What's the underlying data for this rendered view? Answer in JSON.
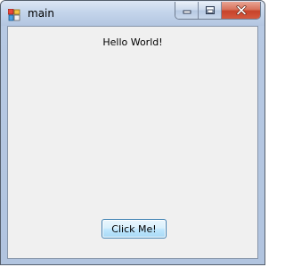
{
  "window": {
    "title": "main",
    "icon": "winforms-app-icon"
  },
  "caption_buttons": {
    "minimize_icon": "minimize-icon",
    "maximize_icon": "maximize-icon",
    "close_icon": "close-icon"
  },
  "form": {
    "label_text": "Hello World!",
    "button_label": "Click Me!"
  },
  "colors": {
    "client_background": "#f0f0f0",
    "close_button": "#c7432a",
    "button_border": "#3c7fb1"
  }
}
